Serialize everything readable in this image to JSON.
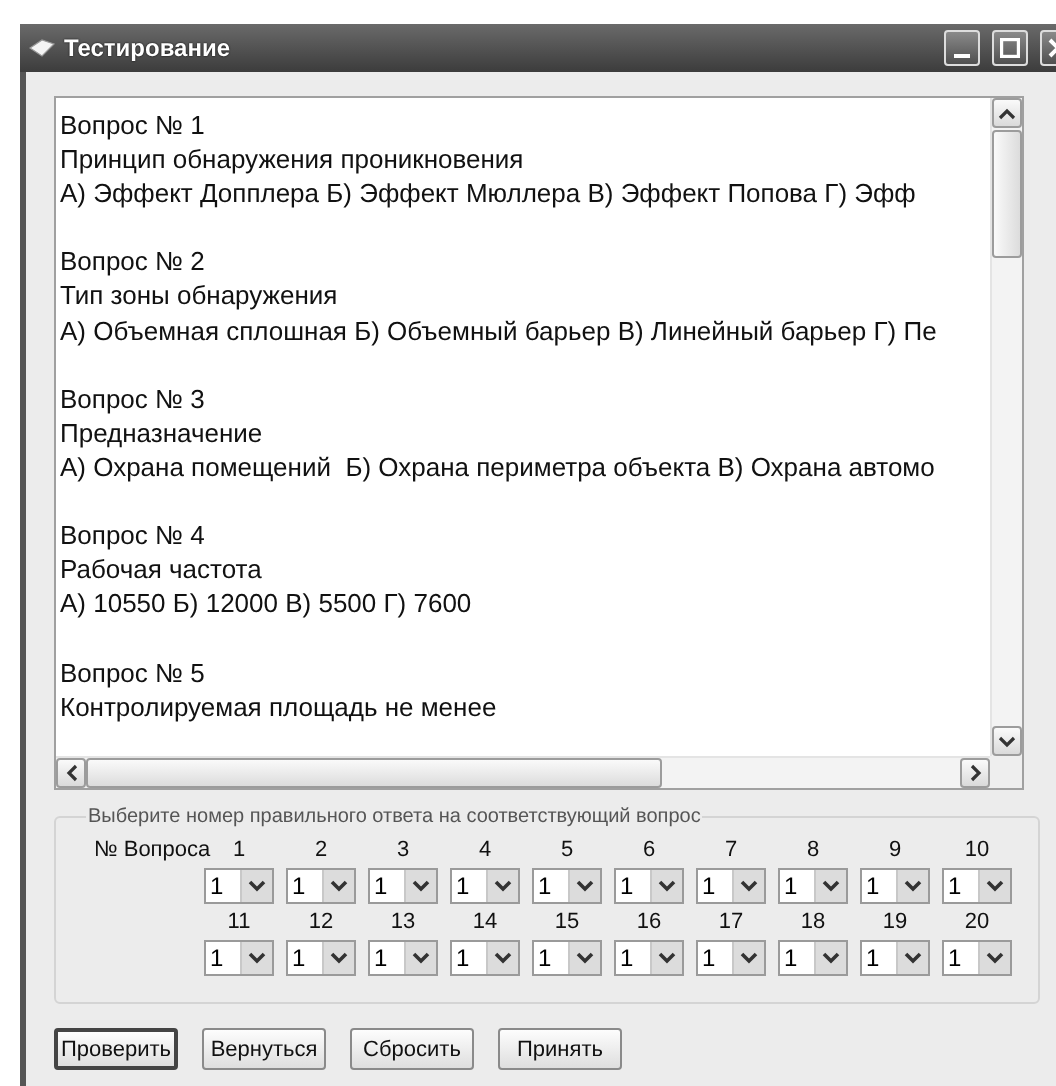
{
  "window": {
    "title": "Тестирование"
  },
  "questions": [
    {
      "header": "Вопрос № 1",
      "text": "Принцип обнаружения проникновения",
      "options": "А) Эффект Допплера Б) Эффект Мюллера В) Эффект Попова Г) Эфф"
    },
    {
      "header": "Вопрос № 2",
      "text": "Тип зоны обнаружения",
      "options": "А) Объемная сплошная Б) Объемный барьер В) Линейный барьер Г) Пе"
    },
    {
      "header": "Вопрос № 3",
      "text": "Предназначение",
      "options": "А) Охрана помещений  Б) Охрана периметра объекта В) Охрана автомо"
    },
    {
      "header": "Вопрос № 4",
      "text": "Рабочая частота",
      "options": "А) 10550 Б) 12000 В) 5500 Г) 7600"
    },
    {
      "header": "Вопрос № 5",
      "text": "Контролируемая площадь не менее"
    }
  ],
  "answers": {
    "legend": "Выберите номер правильного ответа на соответствующий вопрос",
    "row_label": "№ Вопроса",
    "items": [
      {
        "number": "1",
        "value": "1"
      },
      {
        "number": "2",
        "value": "1"
      },
      {
        "number": "3",
        "value": "1"
      },
      {
        "number": "4",
        "value": "1"
      },
      {
        "number": "5",
        "value": "1"
      },
      {
        "number": "6",
        "value": "1"
      },
      {
        "number": "7",
        "value": "1"
      },
      {
        "number": "8",
        "value": "1"
      },
      {
        "number": "9",
        "value": "1"
      },
      {
        "number": "10",
        "value": "1"
      },
      {
        "number": "11",
        "value": "1"
      },
      {
        "number": "12",
        "value": "1"
      },
      {
        "number": "13",
        "value": "1"
      },
      {
        "number": "14",
        "value": "1"
      },
      {
        "number": "15",
        "value": "1"
      },
      {
        "number": "16",
        "value": "1"
      },
      {
        "number": "17",
        "value": "1"
      },
      {
        "number": "18",
        "value": "1"
      },
      {
        "number": "19",
        "value": "1"
      },
      {
        "number": "20",
        "value": "1"
      }
    ]
  },
  "buttons": [
    {
      "label": "Проверить",
      "focused": true
    },
    {
      "label": "Вернуться",
      "focused": false
    },
    {
      "label": "Сбросить",
      "focused": false
    },
    {
      "label": "Принять",
      "focused": false
    }
  ]
}
